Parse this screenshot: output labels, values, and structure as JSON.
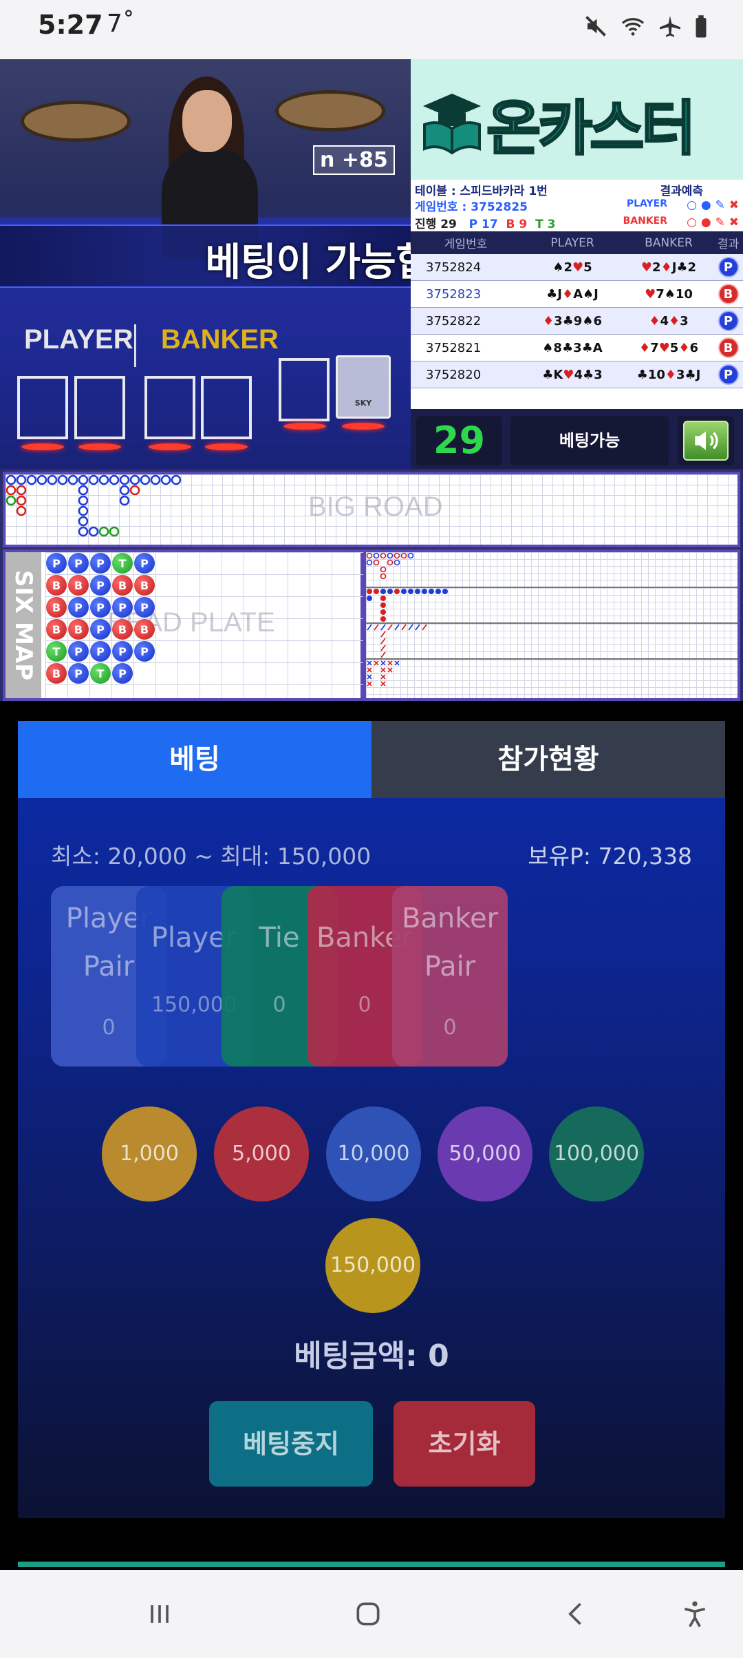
{
  "status": {
    "time": "5:27",
    "temp": "7˚"
  },
  "video": {
    "notice": "베팅이 가능합니다.",
    "badge": "n +85",
    "player_label": "PLAYER",
    "banker_label": "BANKER",
    "shoe_text": "SKY"
  },
  "logo": {
    "text": "온카스터디"
  },
  "table_info": {
    "table": "테이블 : 스피드바카라 1번",
    "prediction_label": "결과예측",
    "game_no": "게임번호 : 3752825",
    "player_pred": "PLAYER",
    "banker_pred": "BANKER",
    "progress": "진행 29",
    "p_count": "P 17",
    "b_count": "B 9",
    "t_count": "T 3"
  },
  "result_table": {
    "headers": [
      "게임번호",
      "PLAYER",
      "BANKER",
      "결과"
    ],
    "rows": [
      {
        "game": "3752824",
        "player": "♠2♥5",
        "banker": "♥2♦J♣2",
        "result": "P"
      },
      {
        "game": "3752823",
        "player": "♣J♦A♠J",
        "banker": "♥7♠10",
        "result": "B"
      },
      {
        "game": "3752822",
        "player": "♦3♣9♠6",
        "banker": "♦4♦3",
        "result": "P"
      },
      {
        "game": "3752821",
        "player": "♠8♣3♣A",
        "banker": "♦7♥5♦6",
        "result": "B"
      },
      {
        "game": "3752820",
        "player": "♣K♥4♣3",
        "banker": "♣10♦3♣J",
        "result": "P"
      }
    ]
  },
  "controls": {
    "count": "29",
    "state": "베팅가능"
  },
  "roads": {
    "bigroad_watermark": "BIG ROAD",
    "sixmap_label": "SIX MAP",
    "bead_watermark": "BEAD PLATE",
    "bead_plate": [
      [
        "P",
        "B",
        "B",
        "B",
        "T",
        "B"
      ],
      [
        "P",
        "B",
        "P",
        "B",
        "P",
        "P"
      ],
      [
        "P",
        "P",
        "P",
        "P",
        "P",
        "T"
      ],
      [
        "T",
        "B",
        "P",
        "B",
        "P",
        "P"
      ],
      [
        "P",
        "B",
        "P",
        "B",
        "P",
        ""
      ]
    ]
  },
  "bet": {
    "tab_betting": "베팅",
    "tab_status": "참가현황",
    "limits": "최소: 20,000 ~ 최대: 150,000",
    "points": "보유P: 720,338",
    "boxes": [
      {
        "name": "Player Pair",
        "amount": "0",
        "color": "#3a58c4"
      },
      {
        "name": "Player",
        "amount": "150,000",
        "color": "#2043b8"
      },
      {
        "name": "Tie",
        "amount": "0",
        "color": "#0f7a64"
      },
      {
        "name": "Banker",
        "amount": "0",
        "color": "#b02a4a"
      },
      {
        "name": "Banker Pair",
        "amount": "0",
        "color": "#a8406e"
      }
    ],
    "chips": [
      {
        "label": "1,000",
        "color": "#b98a2e"
      },
      {
        "label": "5,000",
        "color": "#ac2f3e"
      },
      {
        "label": "10,000",
        "color": "#2f52b6"
      },
      {
        "label": "50,000",
        "color": "#6a3ab0"
      },
      {
        "label": "100,000",
        "color": "#166a5c"
      },
      {
        "label": "150,000",
        "color": "#b8961e"
      }
    ],
    "total": "베팅금액: 0",
    "stop_label": "베팅중지",
    "reset_label": "초기화"
  }
}
